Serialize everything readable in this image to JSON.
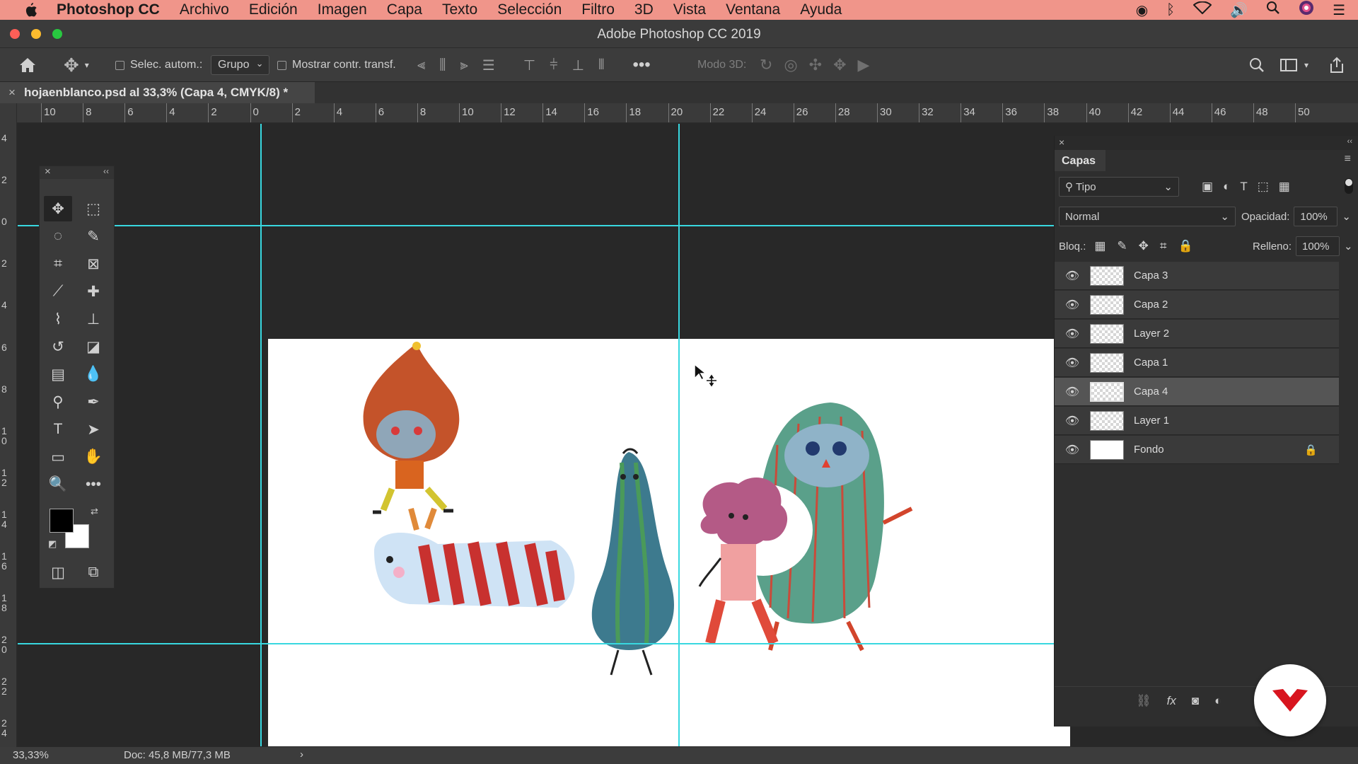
{
  "menubar": {
    "app_name": "Photoshop CC",
    "items": [
      "Archivo",
      "Edición",
      "Imagen",
      "Capa",
      "Texto",
      "Selección",
      "Filtro",
      "3D",
      "Vista",
      "Ventana",
      "Ayuda"
    ]
  },
  "window": {
    "title": "Adobe Photoshop CC 2019"
  },
  "options_bar": {
    "auto_select_label": "Selec. autom.:",
    "auto_select_target": "Grupo",
    "show_transform_label": "Mostrar contr. transf.",
    "mode_3d_label": "Modo 3D:"
  },
  "document_tab": {
    "label": "hojaenblanco.psd al 33,3% (Capa 4, CMYK/8) *"
  },
  "rulers": {
    "horizontal": [
      "10",
      "8",
      "6",
      "4",
      "2",
      "0",
      "2",
      "4",
      "6",
      "8",
      "10",
      "12",
      "14",
      "16",
      "18",
      "20",
      "22",
      "24",
      "26",
      "28",
      "30",
      "32",
      "34",
      "36",
      "38",
      "40",
      "42",
      "44",
      "46",
      "48",
      "50"
    ],
    "vertical": [
      "4",
      "2",
      "0",
      "2",
      "4",
      "6",
      "8",
      "1 0",
      "1 2",
      "1 4",
      "1 6",
      "1 8",
      "2 0",
      "2 2",
      "2 4"
    ]
  },
  "layers_panel": {
    "title": "Capas",
    "filter_kind": "Tipo",
    "blend_mode": "Normal",
    "opacity_label": "Opacidad:",
    "opacity_value": "100%",
    "lock_label": "Bloq.:",
    "fill_label": "Relleno:",
    "fill_value": "100%",
    "layers": [
      {
        "name": "Capa 3",
        "selected": false,
        "locked": false
      },
      {
        "name": "Capa 2",
        "selected": false,
        "locked": false
      },
      {
        "name": "Layer 2",
        "selected": false,
        "locked": false
      },
      {
        "name": "Capa 1",
        "selected": false,
        "locked": false
      },
      {
        "name": "Capa 4",
        "selected": true,
        "locked": false
      },
      {
        "name": "Layer 1",
        "selected": false,
        "locked": false
      },
      {
        "name": "Fondo",
        "selected": false,
        "locked": true
      }
    ]
  },
  "status_bar": {
    "zoom": "33,33%",
    "doc_info": "Doc: 45,8 MB/77,3 MB"
  },
  "colors": {
    "menubar": "#f0958a",
    "guide": "#38d8e0",
    "badge": "#d8151f"
  }
}
